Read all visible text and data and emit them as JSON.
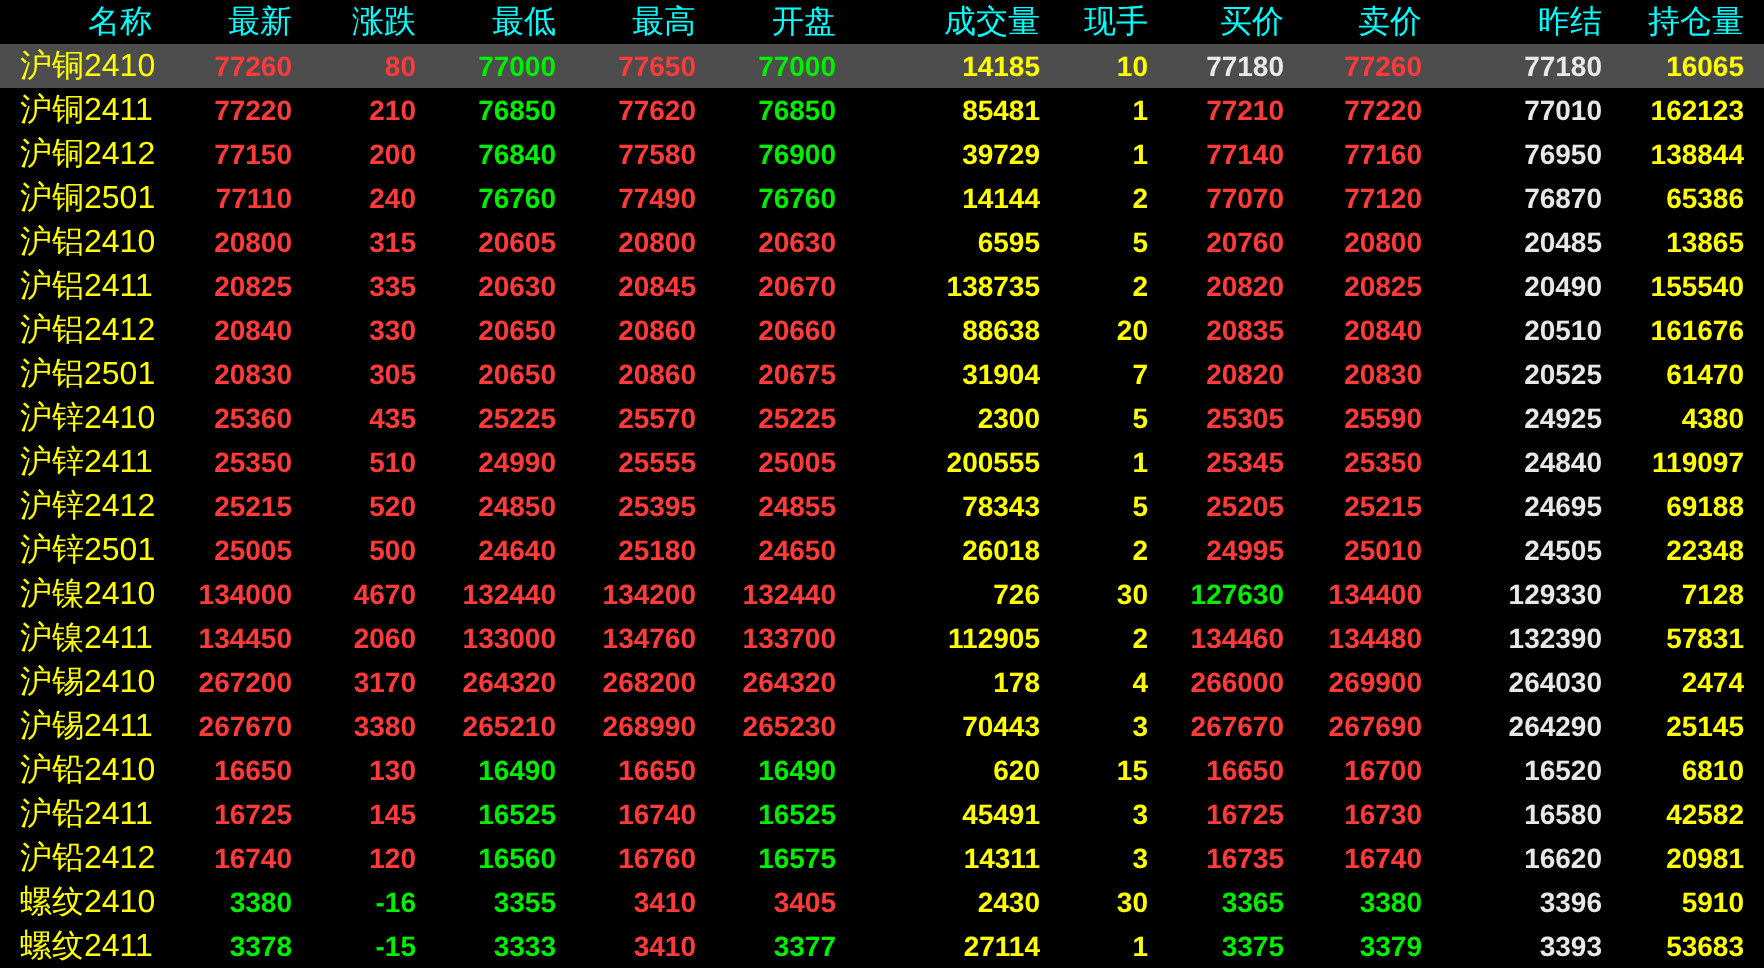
{
  "columns": [
    {
      "label": "名称",
      "kind": "name"
    },
    {
      "label": "最新",
      "kind": "price"
    },
    {
      "label": "涨跌",
      "kind": "price"
    },
    {
      "label": "最低",
      "kind": "price"
    },
    {
      "label": "最高",
      "kind": "price"
    },
    {
      "label": "开盘",
      "kind": "price"
    },
    {
      "label": "成交量",
      "kind": "volume"
    },
    {
      "label": "现手",
      "kind": "volume"
    },
    {
      "label": "买价",
      "kind": "price"
    },
    {
      "label": "卖价",
      "kind": "price"
    },
    {
      "label": "昨结",
      "kind": "settle"
    },
    {
      "label": "持仓量",
      "kind": "volume"
    }
  ],
  "rows": [
    {
      "name": "沪铜2410",
      "selected": true,
      "cells": [
        {
          "text": "77260",
          "color": "#ff3a3a"
        },
        {
          "text": "80",
          "color": "#ff3a3a"
        },
        {
          "text": "77000",
          "color": "#00ee00"
        },
        {
          "text": "77650",
          "color": "#ff3a3a"
        },
        {
          "text": "77000",
          "color": "#00ee00"
        },
        {
          "text": "14185"
        },
        {
          "text": "10"
        },
        {
          "text": "77180",
          "color": "#e8e8e8"
        },
        {
          "text": "77260",
          "color": "#ff3a3a"
        },
        {
          "text": "77180"
        },
        {
          "text": "16065"
        }
      ]
    },
    {
      "name": "沪铜2411",
      "selected": false,
      "cells": [
        {
          "text": "77220",
          "color": "#ff3a3a"
        },
        {
          "text": "210",
          "color": "#ff3a3a"
        },
        {
          "text": "76850",
          "color": "#00ee00"
        },
        {
          "text": "77620",
          "color": "#ff3a3a"
        },
        {
          "text": "76850",
          "color": "#00ee00"
        },
        {
          "text": "85481"
        },
        {
          "text": "1"
        },
        {
          "text": "77210",
          "color": "#ff3a3a"
        },
        {
          "text": "77220",
          "color": "#ff3a3a"
        },
        {
          "text": "77010"
        },
        {
          "text": "162123"
        }
      ]
    },
    {
      "name": "沪铜2412",
      "selected": false,
      "cells": [
        {
          "text": "77150",
          "color": "#ff3a3a"
        },
        {
          "text": "200",
          "color": "#ff3a3a"
        },
        {
          "text": "76840",
          "color": "#00ee00"
        },
        {
          "text": "77580",
          "color": "#ff3a3a"
        },
        {
          "text": "76900",
          "color": "#00ee00"
        },
        {
          "text": "39729"
        },
        {
          "text": "1"
        },
        {
          "text": "77140",
          "color": "#ff3a3a"
        },
        {
          "text": "77160",
          "color": "#ff3a3a"
        },
        {
          "text": "76950"
        },
        {
          "text": "138844"
        }
      ]
    },
    {
      "name": "沪铜2501",
      "selected": false,
      "cells": [
        {
          "text": "77110",
          "color": "#ff3a3a"
        },
        {
          "text": "240",
          "color": "#ff3a3a"
        },
        {
          "text": "76760",
          "color": "#00ee00"
        },
        {
          "text": "77490",
          "color": "#ff3a3a"
        },
        {
          "text": "76760",
          "color": "#00ee00"
        },
        {
          "text": "14144"
        },
        {
          "text": "2"
        },
        {
          "text": "77070",
          "color": "#ff3a3a"
        },
        {
          "text": "77120",
          "color": "#ff3a3a"
        },
        {
          "text": "76870"
        },
        {
          "text": "65386"
        }
      ]
    },
    {
      "name": "沪铝2410",
      "selected": false,
      "cells": [
        {
          "text": "20800",
          "color": "#ff3a3a"
        },
        {
          "text": "315",
          "color": "#ff3a3a"
        },
        {
          "text": "20605",
          "color": "#ff3a3a"
        },
        {
          "text": "20800",
          "color": "#ff3a3a"
        },
        {
          "text": "20630",
          "color": "#ff3a3a"
        },
        {
          "text": "6595"
        },
        {
          "text": "5"
        },
        {
          "text": "20760",
          "color": "#ff3a3a"
        },
        {
          "text": "20800",
          "color": "#ff3a3a"
        },
        {
          "text": "20485"
        },
        {
          "text": "13865"
        }
      ]
    },
    {
      "name": "沪铝2411",
      "selected": false,
      "cells": [
        {
          "text": "20825",
          "color": "#ff3a3a"
        },
        {
          "text": "335",
          "color": "#ff3a3a"
        },
        {
          "text": "20630",
          "color": "#ff3a3a"
        },
        {
          "text": "20845",
          "color": "#ff3a3a"
        },
        {
          "text": "20670",
          "color": "#ff3a3a"
        },
        {
          "text": "138735"
        },
        {
          "text": "2"
        },
        {
          "text": "20820",
          "color": "#ff3a3a"
        },
        {
          "text": "20825",
          "color": "#ff3a3a"
        },
        {
          "text": "20490"
        },
        {
          "text": "155540"
        }
      ]
    },
    {
      "name": "沪铝2412",
      "selected": false,
      "cells": [
        {
          "text": "20840",
          "color": "#ff3a3a"
        },
        {
          "text": "330",
          "color": "#ff3a3a"
        },
        {
          "text": "20650",
          "color": "#ff3a3a"
        },
        {
          "text": "20860",
          "color": "#ff3a3a"
        },
        {
          "text": "20660",
          "color": "#ff3a3a"
        },
        {
          "text": "88638"
        },
        {
          "text": "20"
        },
        {
          "text": "20835",
          "color": "#ff3a3a"
        },
        {
          "text": "20840",
          "color": "#ff3a3a"
        },
        {
          "text": "20510"
        },
        {
          "text": "161676"
        }
      ]
    },
    {
      "name": "沪铝2501",
      "selected": false,
      "cells": [
        {
          "text": "20830",
          "color": "#ff3a3a"
        },
        {
          "text": "305",
          "color": "#ff3a3a"
        },
        {
          "text": "20650",
          "color": "#ff3a3a"
        },
        {
          "text": "20860",
          "color": "#ff3a3a"
        },
        {
          "text": "20675",
          "color": "#ff3a3a"
        },
        {
          "text": "31904"
        },
        {
          "text": "7"
        },
        {
          "text": "20820",
          "color": "#ff3a3a"
        },
        {
          "text": "20830",
          "color": "#ff3a3a"
        },
        {
          "text": "20525"
        },
        {
          "text": "61470"
        }
      ]
    },
    {
      "name": "沪锌2410",
      "selected": false,
      "cells": [
        {
          "text": "25360",
          "color": "#ff3a3a"
        },
        {
          "text": "435",
          "color": "#ff3a3a"
        },
        {
          "text": "25225",
          "color": "#ff3a3a"
        },
        {
          "text": "25570",
          "color": "#ff3a3a"
        },
        {
          "text": "25225",
          "color": "#ff3a3a"
        },
        {
          "text": "2300"
        },
        {
          "text": "5"
        },
        {
          "text": "25305",
          "color": "#ff3a3a"
        },
        {
          "text": "25590",
          "color": "#ff3a3a"
        },
        {
          "text": "24925"
        },
        {
          "text": "4380"
        }
      ]
    },
    {
      "name": "沪锌2411",
      "selected": false,
      "cells": [
        {
          "text": "25350",
          "color": "#ff3a3a"
        },
        {
          "text": "510",
          "color": "#ff3a3a"
        },
        {
          "text": "24990",
          "color": "#ff3a3a"
        },
        {
          "text": "25555",
          "color": "#ff3a3a"
        },
        {
          "text": "25005",
          "color": "#ff3a3a"
        },
        {
          "text": "200555"
        },
        {
          "text": "1"
        },
        {
          "text": "25345",
          "color": "#ff3a3a"
        },
        {
          "text": "25350",
          "color": "#ff3a3a"
        },
        {
          "text": "24840"
        },
        {
          "text": "119097"
        }
      ]
    },
    {
      "name": "沪锌2412",
      "selected": false,
      "cells": [
        {
          "text": "25215",
          "color": "#ff3a3a"
        },
        {
          "text": "520",
          "color": "#ff3a3a"
        },
        {
          "text": "24850",
          "color": "#ff3a3a"
        },
        {
          "text": "25395",
          "color": "#ff3a3a"
        },
        {
          "text": "24855",
          "color": "#ff3a3a"
        },
        {
          "text": "78343"
        },
        {
          "text": "5"
        },
        {
          "text": "25205",
          "color": "#ff3a3a"
        },
        {
          "text": "25215",
          "color": "#ff3a3a"
        },
        {
          "text": "24695"
        },
        {
          "text": "69188"
        }
      ]
    },
    {
      "name": "沪锌2501",
      "selected": false,
      "cells": [
        {
          "text": "25005",
          "color": "#ff3a3a"
        },
        {
          "text": "500",
          "color": "#ff3a3a"
        },
        {
          "text": "24640",
          "color": "#ff3a3a"
        },
        {
          "text": "25180",
          "color": "#ff3a3a"
        },
        {
          "text": "24650",
          "color": "#ff3a3a"
        },
        {
          "text": "26018"
        },
        {
          "text": "2"
        },
        {
          "text": "24995",
          "color": "#ff3a3a"
        },
        {
          "text": "25010",
          "color": "#ff3a3a"
        },
        {
          "text": "24505"
        },
        {
          "text": "22348"
        }
      ]
    },
    {
      "name": "沪镍2410",
      "selected": false,
      "cells": [
        {
          "text": "134000",
          "color": "#ff3a3a"
        },
        {
          "text": "4670",
          "color": "#ff3a3a"
        },
        {
          "text": "132440",
          "color": "#ff3a3a"
        },
        {
          "text": "134200",
          "color": "#ff3a3a"
        },
        {
          "text": "132440",
          "color": "#ff3a3a"
        },
        {
          "text": "726"
        },
        {
          "text": "30"
        },
        {
          "text": "127630",
          "color": "#00ee00"
        },
        {
          "text": "134400",
          "color": "#ff3a3a"
        },
        {
          "text": "129330"
        },
        {
          "text": "7128"
        }
      ]
    },
    {
      "name": "沪镍2411",
      "selected": false,
      "cells": [
        {
          "text": "134450",
          "color": "#ff3a3a"
        },
        {
          "text": "2060",
          "color": "#ff3a3a"
        },
        {
          "text": "133000",
          "color": "#ff3a3a"
        },
        {
          "text": "134760",
          "color": "#ff3a3a"
        },
        {
          "text": "133700",
          "color": "#ff3a3a"
        },
        {
          "text": "112905"
        },
        {
          "text": "2"
        },
        {
          "text": "134460",
          "color": "#ff3a3a"
        },
        {
          "text": "134480",
          "color": "#ff3a3a"
        },
        {
          "text": "132390"
        },
        {
          "text": "57831"
        }
      ]
    },
    {
      "name": "沪锡2410",
      "selected": false,
      "cells": [
        {
          "text": "267200",
          "color": "#ff3a3a"
        },
        {
          "text": "3170",
          "color": "#ff3a3a"
        },
        {
          "text": "264320",
          "color": "#ff3a3a"
        },
        {
          "text": "268200",
          "color": "#ff3a3a"
        },
        {
          "text": "264320",
          "color": "#ff3a3a"
        },
        {
          "text": "178"
        },
        {
          "text": "4"
        },
        {
          "text": "266000",
          "color": "#ff3a3a"
        },
        {
          "text": "269900",
          "color": "#ff3a3a"
        },
        {
          "text": "264030"
        },
        {
          "text": "2474"
        }
      ]
    },
    {
      "name": "沪锡2411",
      "selected": false,
      "cells": [
        {
          "text": "267670",
          "color": "#ff3a3a"
        },
        {
          "text": "3380",
          "color": "#ff3a3a"
        },
        {
          "text": "265210",
          "color": "#ff3a3a"
        },
        {
          "text": "268990",
          "color": "#ff3a3a"
        },
        {
          "text": "265230",
          "color": "#ff3a3a"
        },
        {
          "text": "70443"
        },
        {
          "text": "3"
        },
        {
          "text": "267670",
          "color": "#ff3a3a"
        },
        {
          "text": "267690",
          "color": "#ff3a3a"
        },
        {
          "text": "264290"
        },
        {
          "text": "25145"
        }
      ]
    },
    {
      "name": "沪铅2410",
      "selected": false,
      "cells": [
        {
          "text": "16650",
          "color": "#ff3a3a"
        },
        {
          "text": "130",
          "color": "#ff3a3a"
        },
        {
          "text": "16490",
          "color": "#00ee00"
        },
        {
          "text": "16650",
          "color": "#ff3a3a"
        },
        {
          "text": "16490",
          "color": "#00ee00"
        },
        {
          "text": "620"
        },
        {
          "text": "15"
        },
        {
          "text": "16650",
          "color": "#ff3a3a"
        },
        {
          "text": "16700",
          "color": "#ff3a3a"
        },
        {
          "text": "16520"
        },
        {
          "text": "6810"
        }
      ]
    },
    {
      "name": "沪铅2411",
      "selected": false,
      "cells": [
        {
          "text": "16725",
          "color": "#ff3a3a"
        },
        {
          "text": "145",
          "color": "#ff3a3a"
        },
        {
          "text": "16525",
          "color": "#00ee00"
        },
        {
          "text": "16740",
          "color": "#ff3a3a"
        },
        {
          "text": "16525",
          "color": "#00ee00"
        },
        {
          "text": "45491"
        },
        {
          "text": "3"
        },
        {
          "text": "16725",
          "color": "#ff3a3a"
        },
        {
          "text": "16730",
          "color": "#ff3a3a"
        },
        {
          "text": "16580"
        },
        {
          "text": "42582"
        }
      ]
    },
    {
      "name": "沪铅2412",
      "selected": false,
      "cells": [
        {
          "text": "16740",
          "color": "#ff3a3a"
        },
        {
          "text": "120",
          "color": "#ff3a3a"
        },
        {
          "text": "16560",
          "color": "#00ee00"
        },
        {
          "text": "16760",
          "color": "#ff3a3a"
        },
        {
          "text": "16575",
          "color": "#00ee00"
        },
        {
          "text": "14311"
        },
        {
          "text": "3"
        },
        {
          "text": "16735",
          "color": "#ff3a3a"
        },
        {
          "text": "16740",
          "color": "#ff3a3a"
        },
        {
          "text": "16620"
        },
        {
          "text": "20981"
        }
      ]
    },
    {
      "name": "螺纹2410",
      "selected": false,
      "cells": [
        {
          "text": "3380",
          "color": "#00ee00"
        },
        {
          "text": "-16",
          "color": "#00ee00"
        },
        {
          "text": "3355",
          "color": "#00ee00"
        },
        {
          "text": "3410",
          "color": "#ff3a3a"
        },
        {
          "text": "3405",
          "color": "#ff3a3a"
        },
        {
          "text": "2430"
        },
        {
          "text": "30"
        },
        {
          "text": "3365",
          "color": "#00ee00"
        },
        {
          "text": "3380",
          "color": "#00ee00"
        },
        {
          "text": "3396"
        },
        {
          "text": "5910"
        }
      ]
    },
    {
      "name": "螺纹2411",
      "selected": false,
      "cells": [
        {
          "text": "3378",
          "color": "#00ee00"
        },
        {
          "text": "-15",
          "color": "#00ee00"
        },
        {
          "text": "3333",
          "color": "#00ee00"
        },
        {
          "text": "3410",
          "color": "#ff3a3a"
        },
        {
          "text": "3377",
          "color": "#00ee00"
        },
        {
          "text": "27114"
        },
        {
          "text": "1"
        },
        {
          "text": "3375",
          "color": "#00ee00"
        },
        {
          "text": "3379",
          "color": "#00ee00"
        },
        {
          "text": "3393"
        },
        {
          "text": "53683"
        }
      ]
    }
  ]
}
